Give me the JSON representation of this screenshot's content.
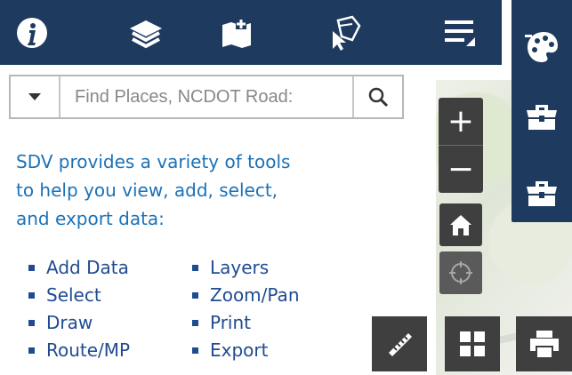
{
  "toolbar": {
    "icons": [
      "info-icon",
      "layers-icon",
      "add-data-icon",
      "select-icon",
      "menu-icon"
    ]
  },
  "side_panel": {
    "icons": [
      "palette-icon",
      "toolbox-icon",
      "toolbox-icon"
    ]
  },
  "search": {
    "placeholder": "Find Places, NCDOT Road:"
  },
  "description": "SDV provides a variety of tools to help you view, add, select, and export data:",
  "tools_left": [
    "Add Data",
    "Select",
    "Draw",
    "Route/MP"
  ],
  "tools_right": [
    "Layers",
    "Zoom/Pan",
    "Print",
    "Export"
  ],
  "map_controls": {
    "zoom_in_label": "+",
    "zoom_out_label": "−"
  },
  "colors": {
    "header": "#1e3a5f",
    "text_primary": "#1b72b8",
    "text_list": "#1f4b91",
    "control_bg": "#3f3f3f"
  }
}
